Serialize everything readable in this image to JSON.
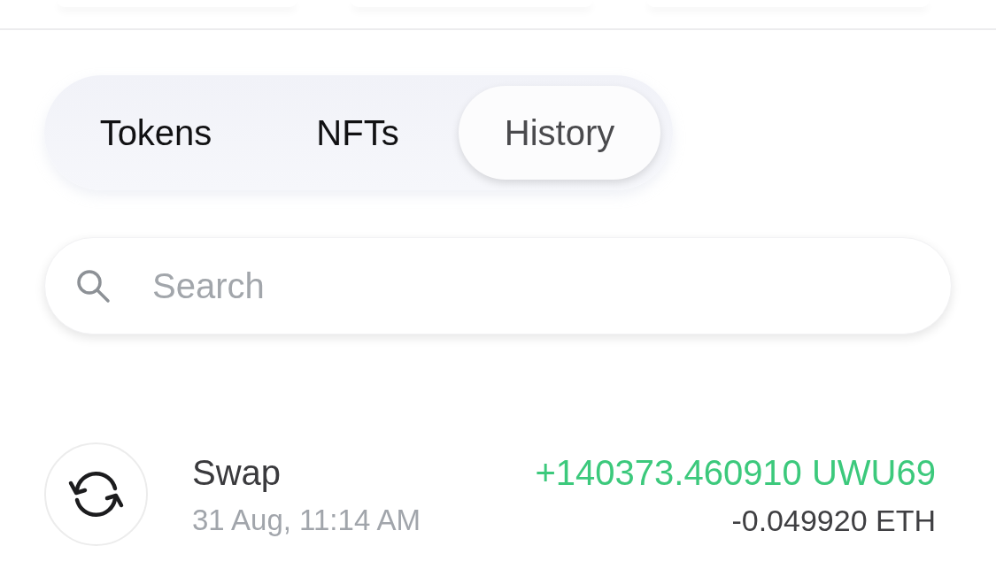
{
  "tabs": [
    {
      "label": "Tokens",
      "selected": false
    },
    {
      "label": "NFTs",
      "selected": false
    },
    {
      "label": "History",
      "selected": true
    }
  ],
  "search": {
    "placeholder": "Search"
  },
  "transactions": [
    {
      "kind": "swap",
      "title": "Swap",
      "time": "31 Aug, 11:14 AM",
      "amounts": [
        {
          "text": "+140373.460910 UWU69",
          "color": "#3cc97c"
        },
        {
          "text": "-0.049920 ETH",
          "color": "#3f3f42"
        }
      ]
    }
  ]
}
